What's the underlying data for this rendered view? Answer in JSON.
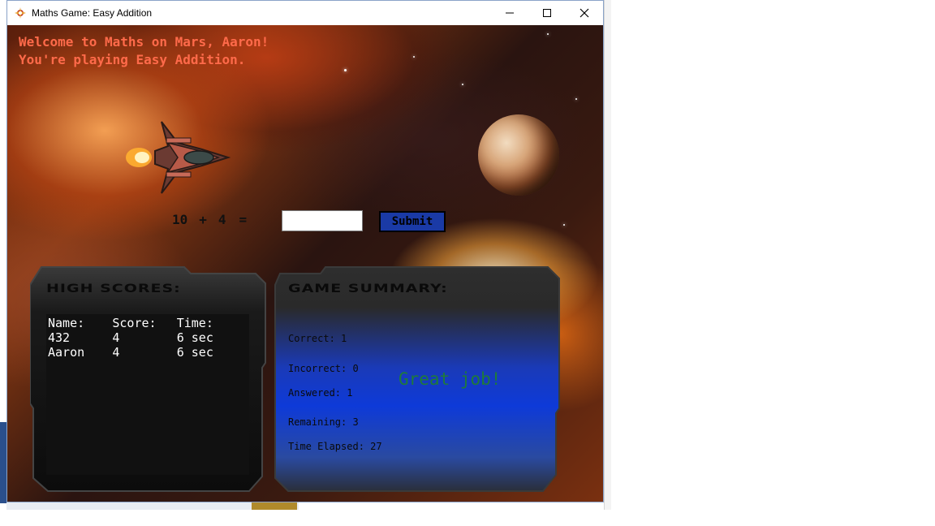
{
  "window": {
    "title": "Maths Game: Easy Addition",
    "controls": [
      "minimize-icon",
      "maximize-icon",
      "close-icon"
    ]
  },
  "welcome": {
    "line1": "Welcome to Maths on Mars, Aaron!",
    "line2": "You're playing Easy Addition."
  },
  "question": {
    "operand1": "10",
    "operator": "+",
    "operand2": "4",
    "equals": "=",
    "answer_value": "",
    "submit_label": "Submit"
  },
  "high_scores": {
    "title": "HIGH SCORES:",
    "columns": [
      "Name:",
      "Score:",
      "Time:"
    ],
    "rows": [
      [
        "432",
        "4",
        "6 sec"
      ],
      [
        "Aaron",
        "4",
        "6 sec"
      ]
    ]
  },
  "game_summary": {
    "title": "GAME SUMMARY:",
    "correct": "Correct: 1",
    "incorrect": "Incorrect: 0",
    "answered": "Answered: 1",
    "remaining": "Remaining: 3",
    "time_elapsed": "Time Elapsed: 27",
    "message": "Great job!"
  },
  "colors": {
    "welcome_text": "#ff6a4a",
    "submit_bg": "#1a3aa6",
    "summary_gradient_mid": "#0e3ad8",
    "message_text": "#1f7a3a"
  }
}
